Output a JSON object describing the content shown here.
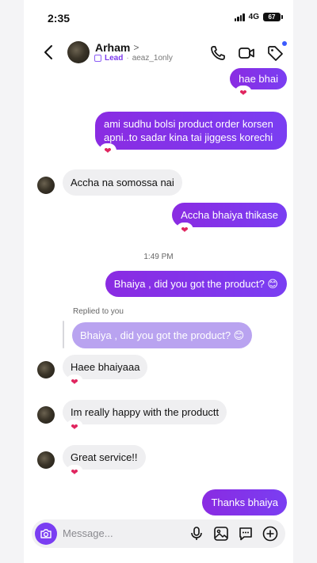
{
  "status": {
    "time": "2:35",
    "network": "4G",
    "battery": "67"
  },
  "header": {
    "name": "Arham",
    "chevron": ">",
    "label": "Lead",
    "separator": "·",
    "handle": "aeaz_1only"
  },
  "messages": {
    "m1": "hae bhai",
    "m2a": "ami sudhu bolsi product order korsen",
    "m2b": "apni..to sadar kina tai jiggess korechi",
    "m3": "Accha na somossa nai",
    "m4": "Accha bhaiya thikase",
    "timestamp": "1:49 PM",
    "m5": "Bhaiya , did you got the product? 😊",
    "replied_label": "Replied to you",
    "quoted": "Bhaiya , did you got the product? 😊",
    "m6": "Haee bhaiyaaa",
    "m7": "Im really happy with the productt",
    "m8": "Great service!!",
    "m9": "Thanks bhaiya"
  },
  "reaction": "❤",
  "composer": {
    "placeholder": "Message..."
  },
  "colors": {
    "outgoing": "#7a3ef2",
    "incoming": "#efeff1",
    "accent": "#3b5bfd",
    "heart": "#e0245e"
  },
  "icons": [
    "back-arrow-icon",
    "phone-icon",
    "video-icon",
    "tag-icon",
    "camera-icon",
    "microphone-icon",
    "gallery-icon",
    "sticker-icon",
    "plus-icon"
  ]
}
